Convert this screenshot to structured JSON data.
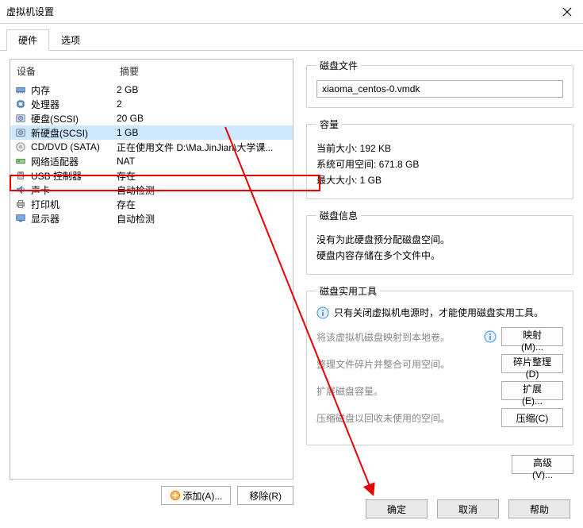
{
  "window": {
    "title": "虚拟机设置"
  },
  "tabs": {
    "hardware": "硬件",
    "options": "选项"
  },
  "columns": {
    "device": "设备",
    "summary": "摘要"
  },
  "devices": [
    {
      "name": "内存",
      "summary": "2 GB",
      "icon": "memory"
    },
    {
      "name": "处理器",
      "summary": "2",
      "icon": "cpu"
    },
    {
      "name": "硬盘(SCSI)",
      "summary": "20 GB",
      "icon": "disk"
    },
    {
      "name": "新硬盘(SCSI)",
      "summary": "1 GB",
      "icon": "disk",
      "selected": true
    },
    {
      "name": "CD/DVD (SATA)",
      "summary": "正在使用文件 D:\\Ma.JinJian\\大学课...",
      "icon": "cd"
    },
    {
      "name": "网络适配器",
      "summary": "NAT",
      "icon": "nic"
    },
    {
      "name": "USB 控制器",
      "summary": "存在",
      "icon": "usb"
    },
    {
      "name": "声卡",
      "summary": "自动检测",
      "icon": "sound"
    },
    {
      "name": "打印机",
      "summary": "存在",
      "icon": "printer"
    },
    {
      "name": "显示器",
      "summary": "自动检测",
      "icon": "display"
    }
  ],
  "buttons": {
    "add": "添加(A)...",
    "remove": "移除(R)",
    "map": "映射(M)...",
    "defrag": "碎片整理(D)",
    "expand": "扩展(E)...",
    "compact": "压缩(C)",
    "advanced": "高级(V)...",
    "ok": "确定",
    "cancel": "取消",
    "help": "帮助"
  },
  "diskfile": {
    "legend": "磁盘文件",
    "value": "xiaoma_centos-0.vmdk"
  },
  "capacity": {
    "legend": "容量",
    "current": "当前大小: 192 KB",
    "free": "系统可用空间: 671.8 GB",
    "max": "最大大小: 1 GB"
  },
  "diskinfo": {
    "legend": "磁盘信息",
    "line1": "没有为此硬盘预分配磁盘空间。",
    "line2": "硬盘内容存储在多个文件中。"
  },
  "util": {
    "legend": "磁盘实用工具",
    "hint": "只有关闭虚拟机电源时，才能使用磁盘实用工具。",
    "map": "将该虚拟机磁盘映射到本地卷。",
    "defrag": "整理文件碎片并整合可用空间。",
    "expand": "扩展磁盘容量。",
    "compact": "压缩磁盘以回收未使用的空间。"
  }
}
